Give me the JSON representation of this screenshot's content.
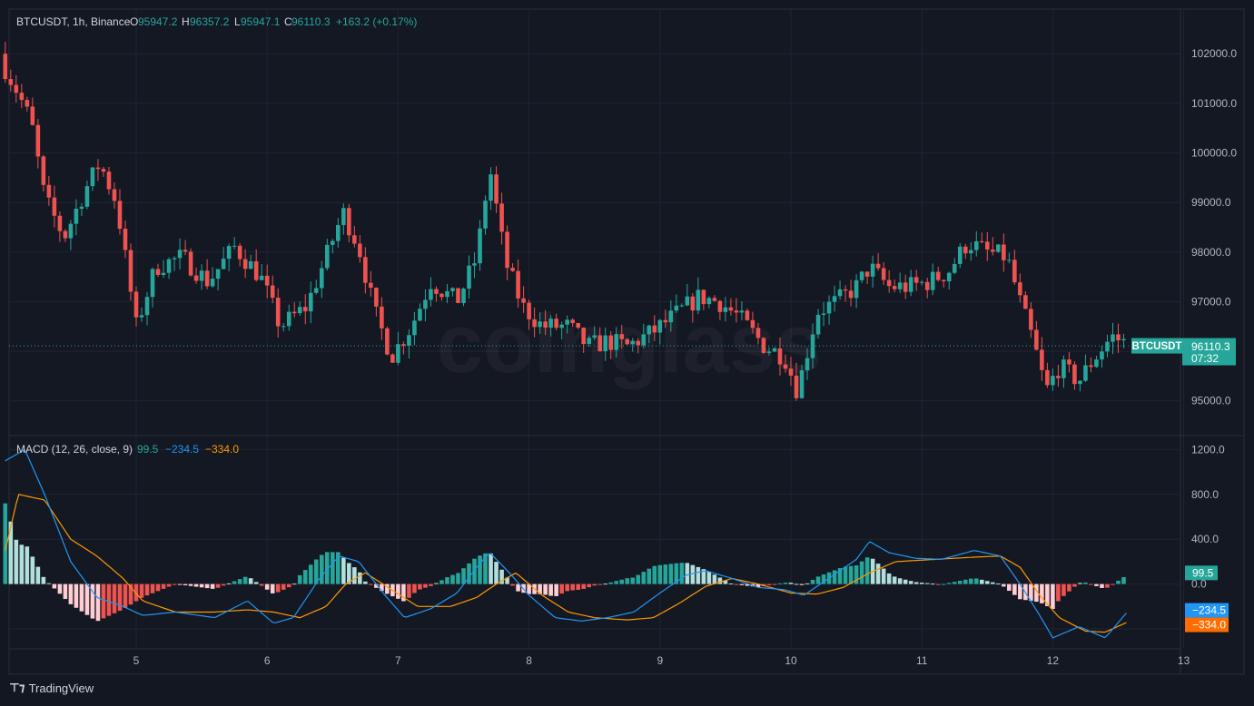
{
  "header": {
    "symbol": "BTCUSDT, 1h, Binance",
    "o_label": "O",
    "o": "95947.2",
    "h_label": "H",
    "h": "96357.2",
    "l_label": "L",
    "l": "95947.1",
    "c_label": "C",
    "c": "96110.3",
    "change": "+163.2 (+0.17%)"
  },
  "watermark": "coinglass",
  "price_badge": {
    "symbol": "BTCUSDT",
    "price": "96110.3",
    "countdown": "07:32"
  },
  "macd_header": {
    "label": "MACD (12, 26, close, 9)",
    "hist": "99.5",
    "macd": "−234.5",
    "signal": "−334.0"
  },
  "macd_badges": {
    "hist": "99.5",
    "macd": "−234.5",
    "signal": "−334.0"
  },
  "footer": {
    "brand": "TradingView"
  },
  "colors": {
    "up": "#26a69a",
    "down": "#ef5350",
    "macd": "#2196f3",
    "signal": "#ff9800",
    "bg": "#131722",
    "grid": "#1f2433"
  },
  "chart_data": [
    {
      "type": "candlestick",
      "title": "BTCUSDT, 1h, Binance",
      "x_tick_labels": [
        "5",
        "6",
        "7",
        "8",
        "9",
        "10",
        "11",
        "12",
        "13"
      ],
      "y_tick_labels": [
        "102000.0",
        "101000.0",
        "100000.0",
        "99000.0",
        "98000.0",
        "97000.0",
        "95000.0"
      ],
      "ylim": [
        94300,
        102900
      ],
      "current_price": 96110.3,
      "grid": true,
      "close_path": [
        [
          4.0,
          101700
        ],
        [
          4.1,
          101200
        ],
        [
          4.2,
          100600
        ],
        [
          4.3,
          99100
        ],
        [
          4.45,
          98300
        ],
        [
          4.6,
          99200
        ],
        [
          4.72,
          99800
        ],
        [
          4.85,
          99000
        ],
        [
          5.0,
          96500
        ],
        [
          5.15,
          97700
        ],
        [
          5.35,
          97900
        ],
        [
          5.55,
          97400
        ],
        [
          5.75,
          98100
        ],
        [
          5.95,
          97500
        ],
        [
          6.1,
          96500
        ],
        [
          6.3,
          96900
        ],
        [
          6.45,
          97900
        ],
        [
          6.58,
          98800
        ],
        [
          6.7,
          98100
        ],
        [
          6.82,
          96800
        ],
        [
          6.95,
          95900
        ],
        [
          7.1,
          96500
        ],
        [
          7.25,
          97400
        ],
        [
          7.45,
          97000
        ],
        [
          7.6,
          97900
        ],
        [
          7.7,
          99700
        ],
        [
          7.82,
          97800
        ],
        [
          7.95,
          96900
        ],
        [
          8.1,
          96500
        ],
        [
          8.3,
          96500
        ],
        [
          8.45,
          96100
        ],
        [
          8.6,
          96200
        ],
        [
          8.75,
          96100
        ],
        [
          8.95,
          96400
        ],
        [
          9.15,
          96800
        ],
        [
          9.3,
          97100
        ],
        [
          9.45,
          97000
        ],
        [
          9.6,
          96700
        ],
        [
          9.8,
          96100
        ],
        [
          9.95,
          95900
        ],
        [
          10.05,
          95200
        ],
        [
          10.2,
          96800
        ],
        [
          10.35,
          97000
        ],
        [
          10.5,
          97300
        ],
        [
          10.6,
          97700
        ],
        [
          10.75,
          97300
        ],
        [
          10.9,
          97300
        ],
        [
          11.05,
          97400
        ],
        [
          11.2,
          97600
        ],
        [
          11.35,
          98200
        ],
        [
          11.5,
          98000
        ],
        [
          11.65,
          97900
        ],
        [
          11.75,
          97000
        ],
        [
          11.85,
          96200
        ],
        [
          11.95,
          95200
        ],
        [
          12.05,
          95700
        ],
        [
          12.2,
          95400
        ],
        [
          12.3,
          95800
        ],
        [
          12.45,
          96300
        ],
        [
          12.6,
          96110
        ]
      ]
    },
    {
      "type": "macd",
      "title": "MACD (12, 26, close, 9)",
      "series": [
        {
          "name": "MACD",
          "x": [
            4.0,
            4.15,
            4.3,
            4.5,
            4.7,
            4.9,
            5.05,
            5.3,
            5.6,
            5.85,
            6.05,
            6.2,
            6.4,
            6.55,
            6.7,
            6.9,
            7.05,
            7.25,
            7.45,
            7.6,
            7.7,
            7.85,
            8.0,
            8.2,
            8.4,
            8.6,
            8.8,
            9.0,
            9.2,
            9.35,
            9.55,
            9.75,
            9.95,
            10.1,
            10.3,
            10.5,
            10.6,
            10.75,
            10.95,
            11.15,
            11.4,
            11.6,
            11.75,
            11.9,
            12.0,
            12.2,
            12.4,
            12.58
          ],
          "values": [
            1100,
            1200,
            800,
            200,
            -120,
            -200,
            -280,
            -250,
            -300,
            -150,
            -350,
            -300,
            50,
            250,
            200,
            -100,
            -300,
            -220,
            -80,
            150,
            280,
            100,
            -100,
            -300,
            -330,
            -300,
            -250,
            -80,
            80,
            120,
            50,
            -30,
            -50,
            -100,
            60,
            220,
            380,
            280,
            230,
            220,
            300,
            250,
            0,
            -280,
            -480,
            -380,
            -480,
            -234.5
          ]
        },
        {
          "name": "Signal",
          "x": [
            4.0,
            4.1,
            4.3,
            4.5,
            4.7,
            4.9,
            5.05,
            5.3,
            5.6,
            5.85,
            6.05,
            6.25,
            6.45,
            6.6,
            6.75,
            6.95,
            7.15,
            7.4,
            7.6,
            7.75,
            7.9,
            8.1,
            8.3,
            8.5,
            8.75,
            8.95,
            9.15,
            9.35,
            9.55,
            9.75,
            10.0,
            10.2,
            10.4,
            10.6,
            10.8,
            11.1,
            11.4,
            11.6,
            11.75,
            11.9,
            12.05,
            12.25,
            12.4,
            12.58
          ],
          "values": [
            300,
            800,
            750,
            400,
            250,
            50,
            -150,
            -250,
            -250,
            -230,
            -250,
            -300,
            -200,
            0,
            100,
            -50,
            -200,
            -200,
            -120,
            0,
            100,
            -100,
            -250,
            -300,
            -320,
            -300,
            -170,
            -20,
            50,
            0,
            -80,
            -90,
            -30,
            100,
            200,
            220,
            240,
            250,
            150,
            -100,
            -300,
            -420,
            -430,
            -334.0
          ]
        }
      ],
      "histogram": {
        "x_start": 4.0,
        "x_end": 12.58,
        "current": 99.5
      },
      "x_tick_labels": [
        "5",
        "6",
        "7",
        "8",
        "9",
        "10",
        "11",
        "12",
        "13"
      ],
      "y_tick_labels": [
        "1200.0",
        "800.0",
        "400.0",
        "0.0"
      ],
      "ylim": [
        -570,
        1260
      ],
      "values_shown": {
        "histogram": 99.5,
        "macd": -234.5,
        "signal": -334.0
      }
    }
  ]
}
